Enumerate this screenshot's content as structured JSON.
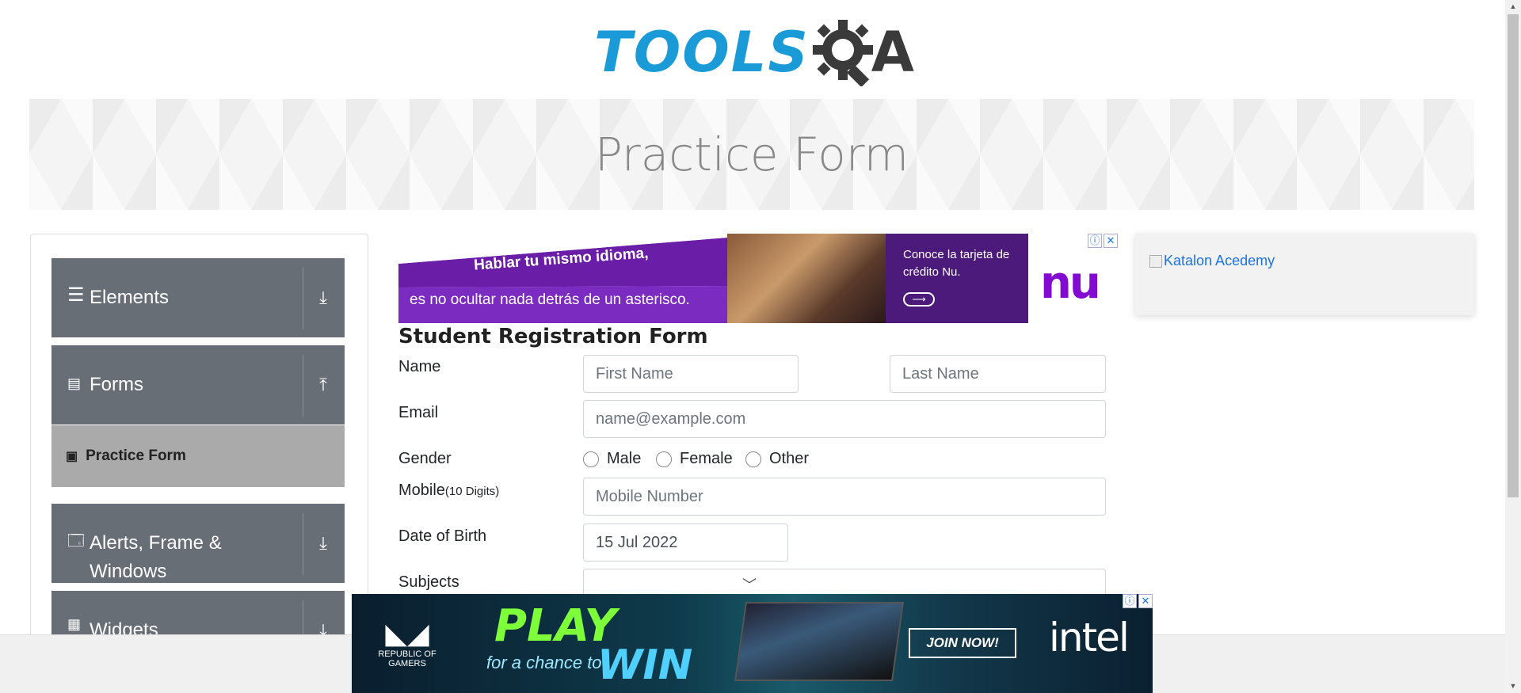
{
  "header": {
    "logo_tools": "TOOLS",
    "logo_qa": "A"
  },
  "banner": {
    "title": "Practice Form"
  },
  "sidebar": {
    "groups": [
      {
        "label": "Elements",
        "icon": "hamburger-icon",
        "arrow": "download-arrow-icon"
      },
      {
        "label": "Forms",
        "icon": "document-icon",
        "arrow": "upload-arrow-icon"
      },
      {
        "label": "Alerts, Frame & Windows",
        "icon": "window-icon",
        "arrow": "download-arrow-icon"
      },
      {
        "label": "Widgets",
        "icon": "widgets-icon",
        "arrow": "download-arrow-icon"
      }
    ],
    "active_item": {
      "label": "Practice Form",
      "icon": "html5-icon"
    }
  },
  "ad_top": {
    "line1": "Hablar tu mismo idioma,",
    "line2": "es no ocultar nada detrás de un asterisco.",
    "card_text": "Conoce la tarjeta de crédito Nu.",
    "brand": "nu"
  },
  "ad_right": {
    "alt_text": "Katalon Acedemy"
  },
  "form": {
    "title": "Student Registration Form",
    "name_label": "Name",
    "first_name_placeholder": "First Name",
    "last_name_placeholder": "Last Name",
    "email_label": "Email",
    "email_placeholder": "name@example.com",
    "gender_label": "Gender",
    "gender_options": [
      "Male",
      "Female",
      "Other"
    ],
    "mobile_label": "Mobile",
    "mobile_hint": "(10 Digits)",
    "mobile_placeholder": "Mobile Number",
    "dob_label": "Date of Birth",
    "dob_value": "15 Jul 2022",
    "subjects_label": "Subjects"
  },
  "ad_bottom": {
    "rog_text": "REPUBLIC OF GAMERS",
    "play": "PLAY",
    "chance": "for a chance to",
    "win": "WIN",
    "cta": "JOIN NOW!",
    "brand": "intel"
  },
  "colors": {
    "tools_blue": "#1a9ad6",
    "sidebar_gray": "#686e76",
    "active_gray": "#aaaaaa",
    "nu_purple": "#820ad1"
  }
}
